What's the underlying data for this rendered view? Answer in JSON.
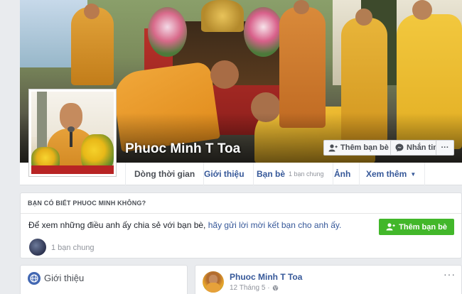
{
  "profile": {
    "name": "Phuoc Minh T Toa"
  },
  "cover_buttons": {
    "add_friend": "Thêm bạn bè",
    "message": "Nhắn tin",
    "more": "···"
  },
  "tabs": [
    {
      "label": "Dòng thời gian",
      "sub": ""
    },
    {
      "label": "Giới thiệu",
      "sub": ""
    },
    {
      "label": "Bạn bè",
      "sub": "1 bạn chung"
    },
    {
      "label": "Ảnh",
      "sub": ""
    },
    {
      "label": "Xem thêm",
      "sub": "▼"
    }
  ],
  "suggestion": {
    "heading": "BẠN CÓ BIẾT PHUOC MINH KHÔNG?",
    "message_prefix": "Để xem những điều anh ấy chia sẻ với bạn bè, ",
    "message_link": "hãy gửi lời mời kết bạn cho anh ấy.",
    "add_friend": "Thêm bạn bè",
    "mutual": "1 bạn chung"
  },
  "intro": {
    "title": "Giới thiệu"
  },
  "post": {
    "author": "Phuoc Minh T Toa",
    "date": "12 Tháng 5 ·",
    "more": "···"
  },
  "colors": {
    "link": "#365899",
    "green": "#42b72a",
    "background": "#e9ebee"
  }
}
